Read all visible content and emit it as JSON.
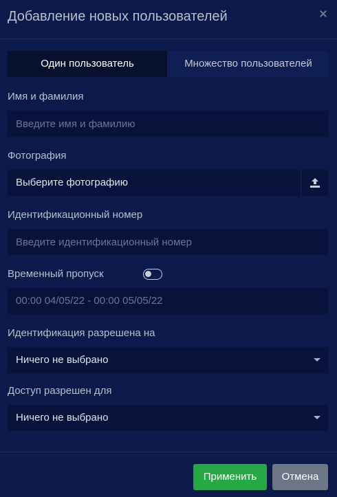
{
  "dialog": {
    "title": "Добавление новых пользователей",
    "close_icon": "close-icon"
  },
  "tabs": [
    {
      "label": "Один пользователь",
      "active": true
    },
    {
      "label": "Множество пользователей",
      "active": false
    }
  ],
  "fields": {
    "name": {
      "label": "Имя и фамилия",
      "placeholder": "Введите имя и фамилию",
      "value": ""
    },
    "photo": {
      "label": "Фотография",
      "value": "Выберите фотографию",
      "icon": "upload-icon"
    },
    "id_number": {
      "label": "Идентификационный номер",
      "placeholder": "Введите идентификационный номер",
      "value": ""
    },
    "temp_pass": {
      "label": "Временный пропуск",
      "toggle_on": false,
      "range": "00:00 04/05/22 - 00:00 05/05/22"
    },
    "identification": {
      "label": "Идентификация разрешена на",
      "selected": "Ничего не выбрано",
      "icon": "caret-down-icon"
    },
    "access": {
      "label": "Доступ разрешен для",
      "selected": "Ничего не выбрано",
      "icon": "caret-down-icon"
    }
  },
  "footer": {
    "apply_label": "Применить",
    "cancel_label": "Отмена"
  },
  "colors": {
    "background": "#0b1a4a",
    "field": "#08123a",
    "apply": "#27a844",
    "cancel": "#6c7686"
  }
}
